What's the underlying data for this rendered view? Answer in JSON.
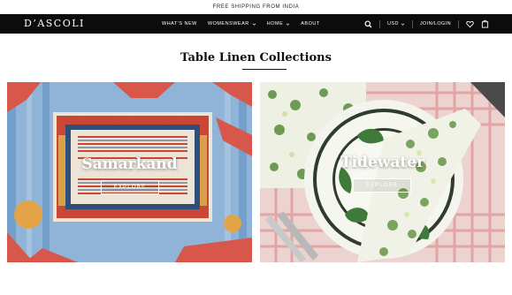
{
  "announcement": "FREE SHIPPING FROM INDIA",
  "brand": {
    "logo": "D’ASCOLI"
  },
  "nav": {
    "items": [
      {
        "label": "WHAT'S NEW",
        "has_dropdown": false
      },
      {
        "label": "WOMENSWEAR",
        "has_dropdown": true
      },
      {
        "label": "HOME",
        "has_dropdown": true
      },
      {
        "label": "ABOUT",
        "has_dropdown": false
      }
    ],
    "currency": "USD",
    "account": "JOIN/LOGIN",
    "icons": [
      "search-icon",
      "chevron-down-icon",
      "heart-icon",
      "bag-icon"
    ]
  },
  "page": {
    "title": "Table Linen Collections"
  },
  "collections": [
    {
      "title": "Samarkand",
      "cta": "EXPLORE"
    },
    {
      "title": "Tidewater",
      "cta": "EXPLORE"
    }
  ],
  "colors": {
    "nav_bg": "#0c0c0c",
    "text": "#111111",
    "ikat_blue": "#6f9cc8",
    "ikat_red": "#c94734",
    "floral_green": "#5f8a4c",
    "gingham_red": "#d77a7a"
  }
}
